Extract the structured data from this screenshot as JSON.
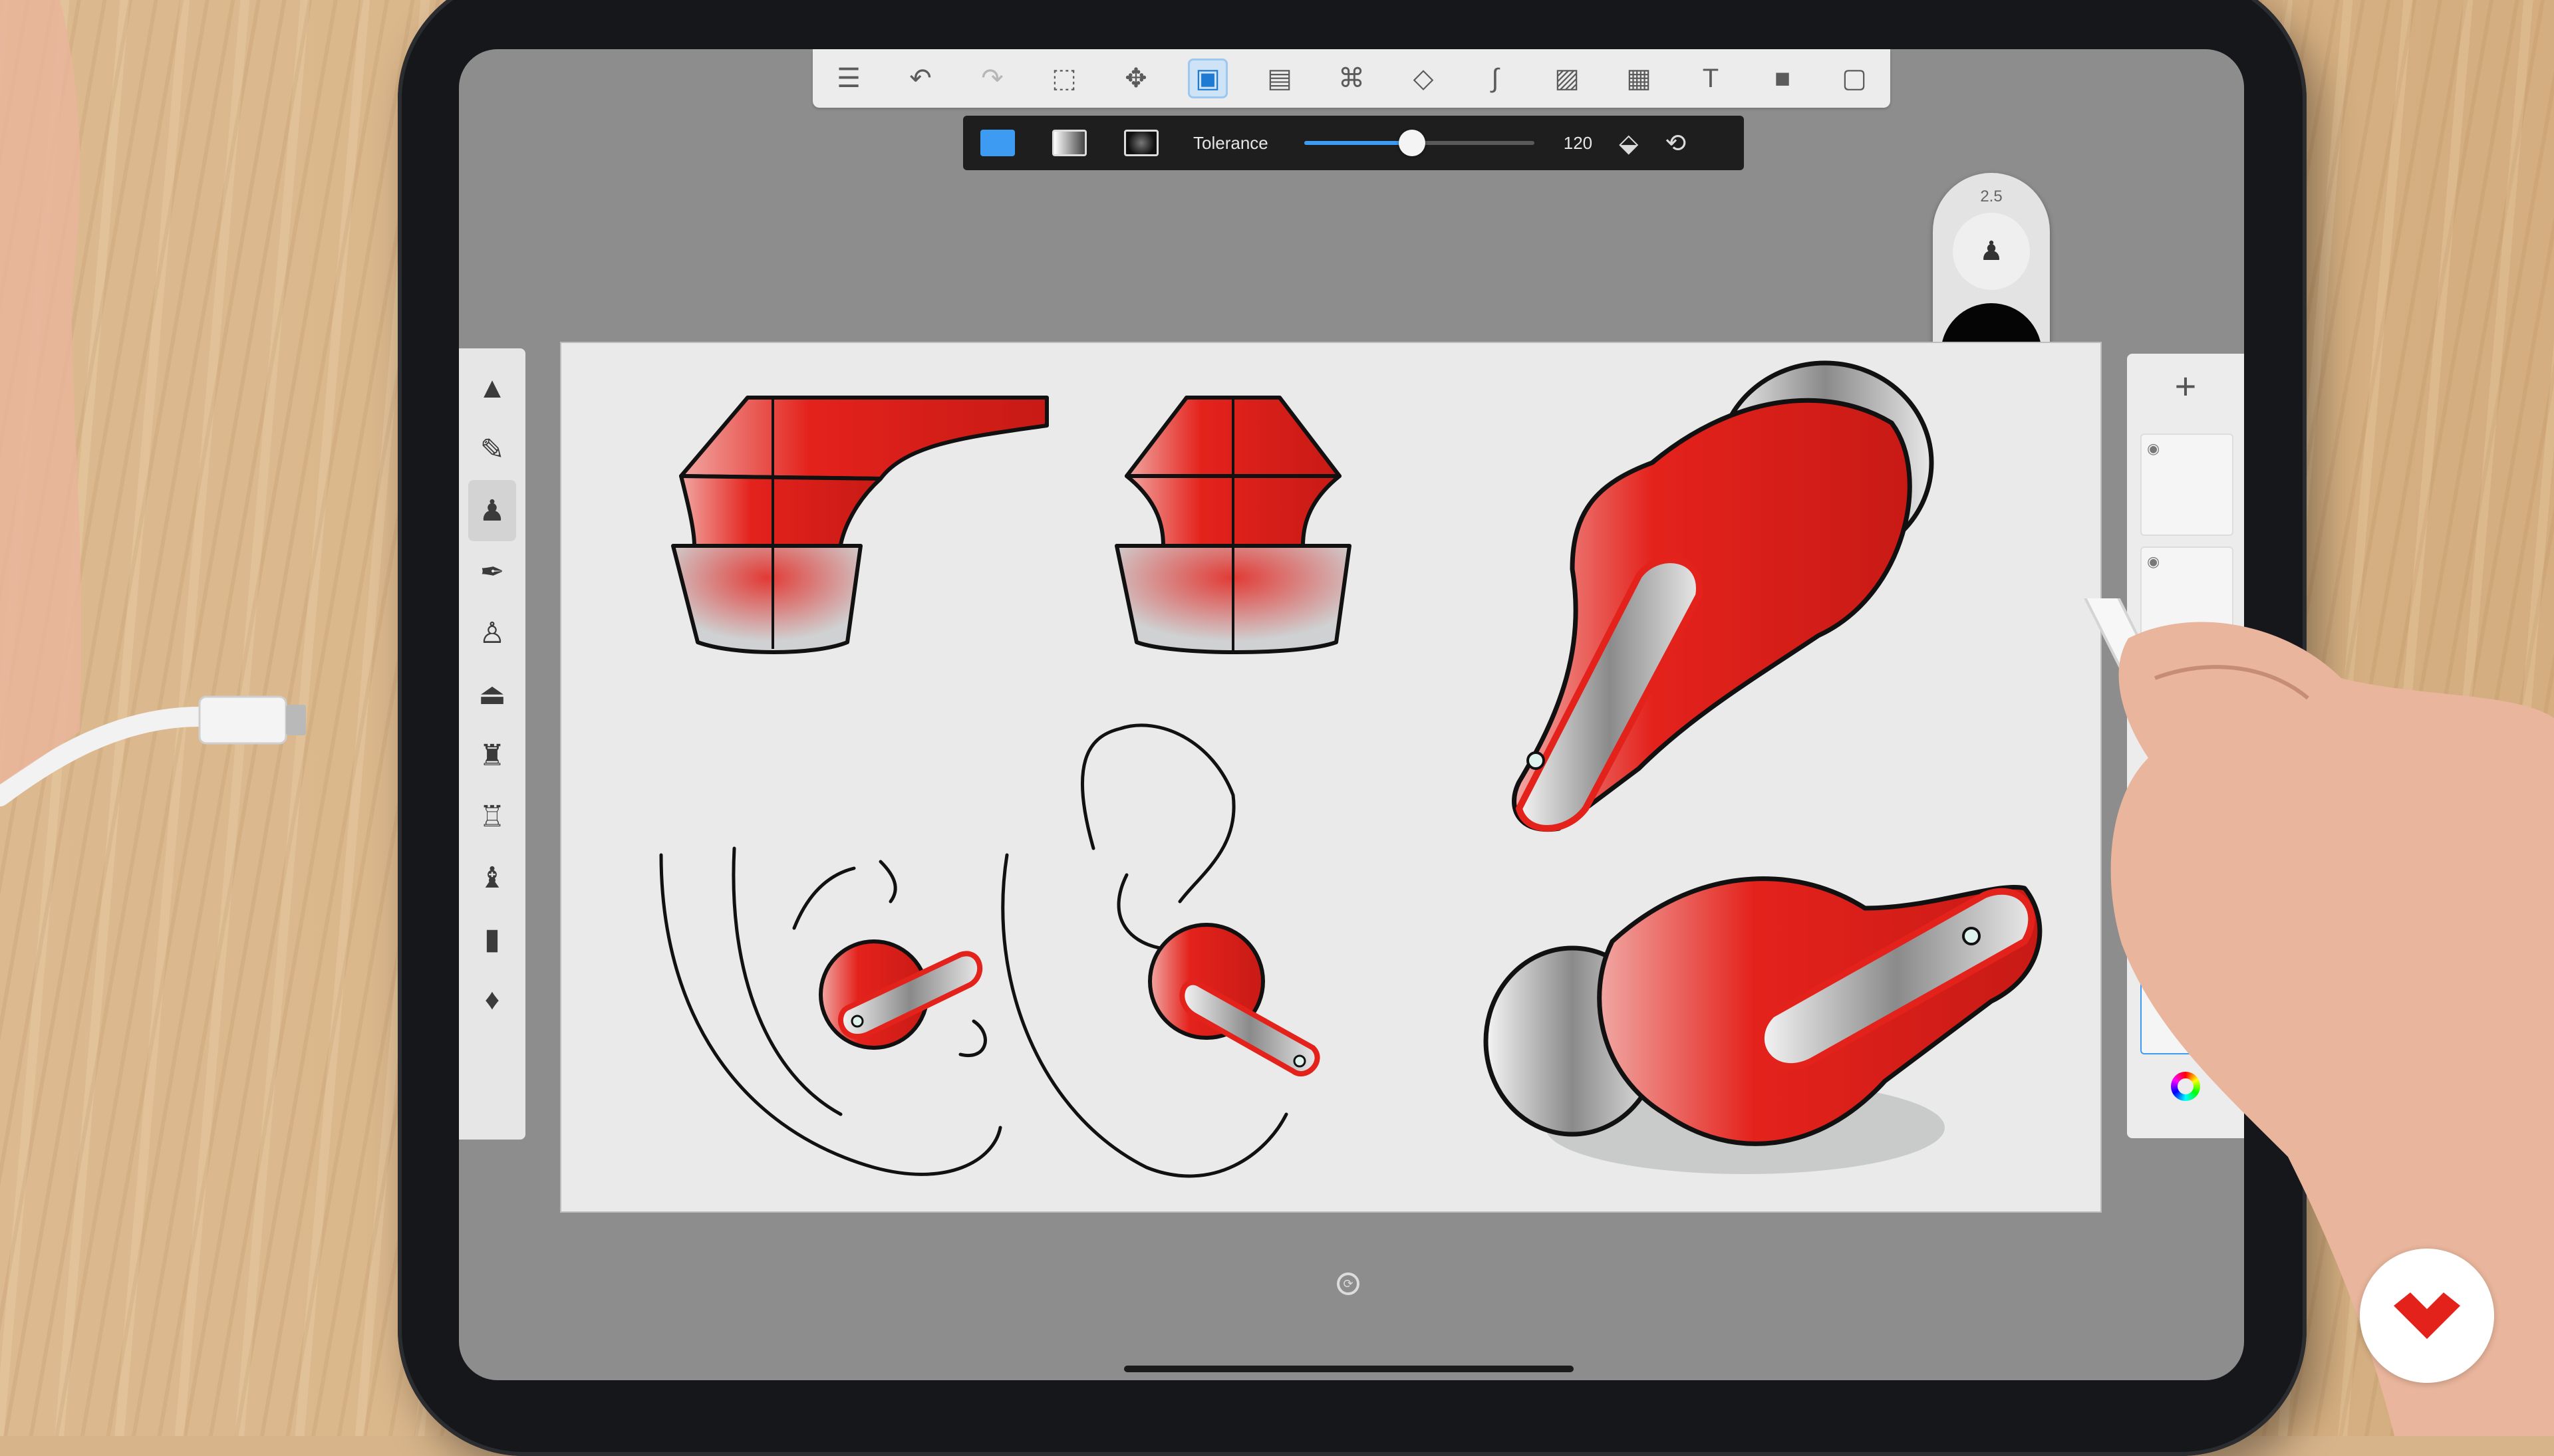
{
  "toolbar": {
    "tools": [
      {
        "name": "layers-list-icon",
        "glyph": "☰"
      },
      {
        "name": "undo-icon",
        "glyph": "↶"
      },
      {
        "name": "redo-icon",
        "glyph": "↷"
      },
      {
        "name": "selection-icon",
        "glyph": "⬚"
      },
      {
        "name": "transform-icon",
        "glyph": "✥"
      },
      {
        "name": "fill-icon",
        "glyph": "▣"
      },
      {
        "name": "ruler-icon",
        "glyph": "▤"
      },
      {
        "name": "symmetry-icon",
        "glyph": "⌘"
      },
      {
        "name": "shapes-icon",
        "glyph": "◇"
      },
      {
        "name": "stroke-icon",
        "glyph": "∫"
      },
      {
        "name": "image-icon",
        "glyph": "▨"
      },
      {
        "name": "perspective-icon",
        "glyph": "▦"
      },
      {
        "name": "text-icon",
        "glyph": "T"
      },
      {
        "name": "record-icon",
        "glyph": "■"
      },
      {
        "name": "fullscreen-icon",
        "glyph": "▢"
      }
    ]
  },
  "fill_bar": {
    "tolerance_label": "Tolerance",
    "tolerance_value": "120",
    "tolerance_fraction": 0.47
  },
  "brush_puck": {
    "size": "2.5",
    "color": "#050505"
  },
  "colors": {
    "accent": "#3d9cf2",
    "sketch_red": "#e4221c"
  }
}
